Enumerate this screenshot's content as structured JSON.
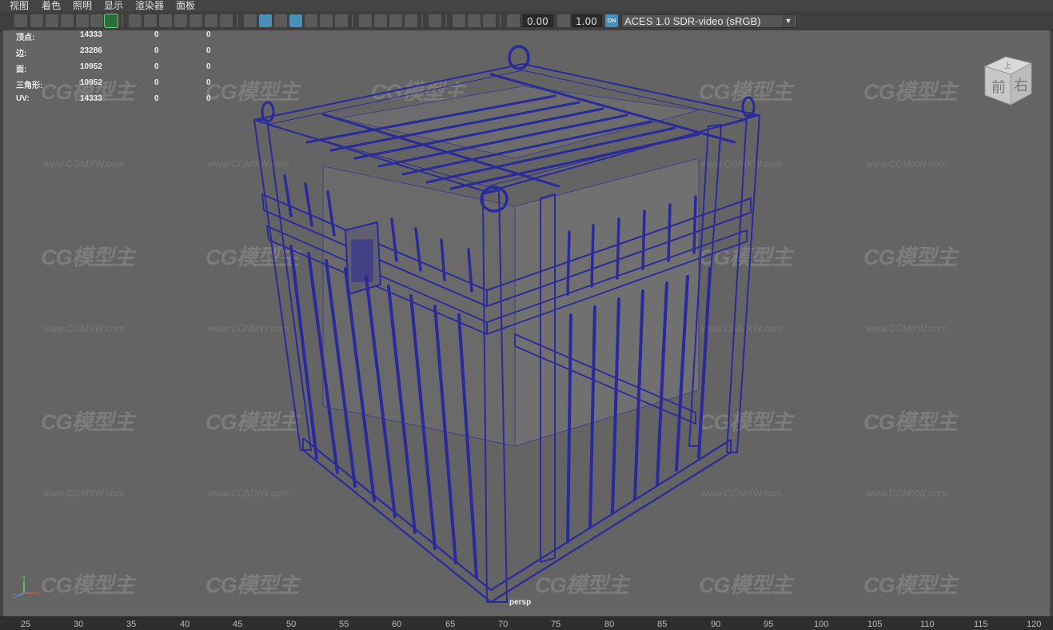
{
  "menu": [
    "视图",
    "着色",
    "照明",
    "显示",
    "渲染器",
    "面板"
  ],
  "toolbar": {
    "field1_value": "0.00",
    "field2_value": "1.00",
    "color_space": "ACES 1.0 SDR-video (sRGB)",
    "color_space_toggle_label": "ON",
    "dropdown_arrow": "▼"
  },
  "hud": {
    "rows": [
      {
        "label": "顶点:",
        "v1": "14333",
        "v2": "0",
        "v3": "0"
      },
      {
        "label": "边:",
        "v1": "23286",
        "v2": "0",
        "v3": "0"
      },
      {
        "label": "面:",
        "v1": "10952",
        "v2": "0",
        "v3": "0"
      },
      {
        "label": "三角形:",
        "v1": "10952",
        "v2": "0",
        "v3": "0"
      },
      {
        "label": "UV:",
        "v1": "14333",
        "v2": "0",
        "v3": "0"
      }
    ]
  },
  "viewcube": {
    "top": "上",
    "front": "前",
    "right": "右"
  },
  "axis": {
    "y": "Y",
    "x": "X",
    "z": "Z"
  },
  "camera_label": "persp",
  "watermark": {
    "logo": "CG模型主",
    "url": "www.CGMXW.com"
  },
  "timeline_ticks": [
    "25",
    "30",
    "35",
    "40",
    "45",
    "50",
    "55",
    "60",
    "65",
    "70",
    "75",
    "80",
    "85",
    "90",
    "95",
    "100",
    "105",
    "110",
    "115",
    "120"
  ],
  "colors": {
    "wireframe": "#2b2a9a",
    "viewport_bg": "#646464",
    "accent": "#4a8fb8"
  }
}
